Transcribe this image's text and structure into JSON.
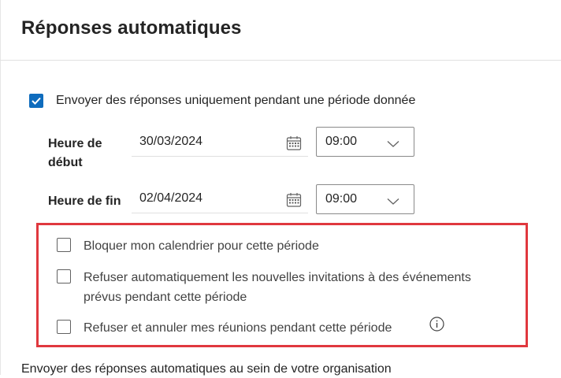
{
  "page": {
    "title": "Réponses automatiques"
  },
  "period": {
    "checkbox_label": "Envoyer des réponses uniquement pendant une période donnée",
    "checked": true,
    "start": {
      "label_line1": "Heure de",
      "label_line2": "début",
      "date": "30/03/2024",
      "time": "09:00"
    },
    "end": {
      "label": "Heure de fin",
      "date": "02/04/2024",
      "time": "09:00"
    }
  },
  "options": [
    {
      "label": "Bloquer mon calendrier pour cette période",
      "checked": false
    },
    {
      "label_line1": "Refuser automatiquement les nouvelles invitations à des événements",
      "label_line2": "prévus pendant cette période",
      "checked": false
    },
    {
      "label": "Refuser et annuler mes réunions pendant cette période",
      "checked": false,
      "has_info": true
    }
  ],
  "bottom": {
    "text": "Envoyer des réponses automatiques au sein de votre organisation"
  },
  "colors": {
    "accent": "#0f6cbd",
    "highlight": "#e0383e"
  },
  "icons": {
    "checkmark": "checkmark-icon",
    "calendar": "calendar-icon",
    "chevron": "chevron-down-icon",
    "info": "info-icon"
  }
}
